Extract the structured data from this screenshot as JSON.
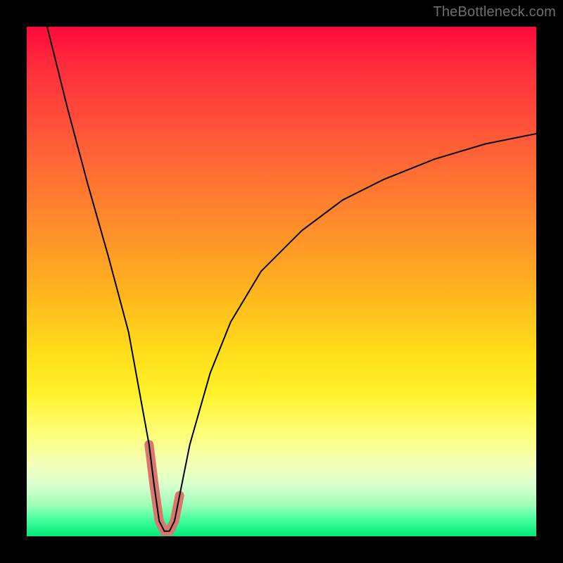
{
  "watermark": "TheBottleneck.com",
  "chart_data": {
    "type": "line",
    "title": "",
    "xlabel": "",
    "ylabel": "",
    "xlim": [
      0,
      100
    ],
    "ylim": [
      0,
      100
    ],
    "grid": false,
    "legend": false,
    "annotations": [],
    "series": [
      {
        "name": "bottleneck-curve",
        "color": "#000000",
        "stroke_width": 2,
        "x": [
          4,
          8,
          12,
          16,
          20,
          24,
          25,
          26,
          27,
          28,
          29,
          30,
          32,
          36,
          40,
          46,
          54,
          62,
          70,
          80,
          90,
          100
        ],
        "values": [
          100,
          84,
          69,
          55,
          40,
          18,
          10,
          3,
          1,
          1,
          3,
          8,
          18,
          32,
          42,
          52,
          60,
          66,
          70,
          74,
          77,
          79
        ]
      },
      {
        "name": "highlight-segment",
        "color": "#d9766d",
        "stroke_width": 13,
        "x": [
          24,
          25,
          26,
          27,
          28,
          29,
          30
        ],
        "values": [
          18,
          10,
          3,
          1,
          1,
          3,
          8
        ]
      }
    ],
    "background_gradient": {
      "type": "vertical",
      "stops": [
        {
          "pos": 0,
          "color": "#ff0a3a"
        },
        {
          "pos": 38,
          "color": "#ff8a2c"
        },
        {
          "pos": 64,
          "color": "#ffde1a"
        },
        {
          "pos": 86,
          "color": "#f3ffb8"
        },
        {
          "pos": 100,
          "color": "#00e87a"
        }
      ]
    }
  }
}
